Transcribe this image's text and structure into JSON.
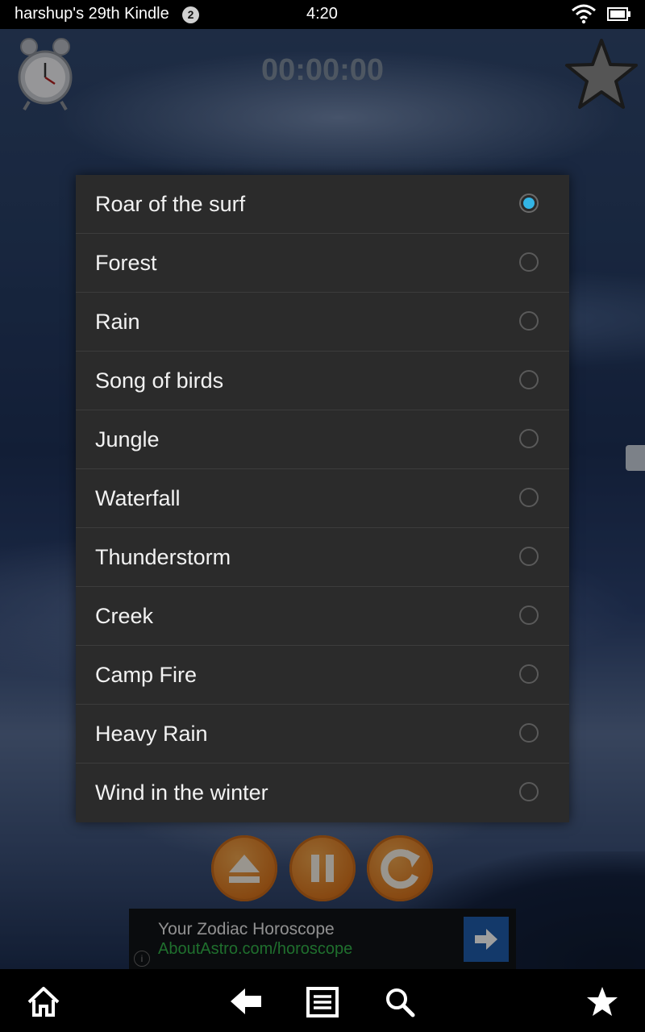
{
  "status_bar": {
    "device_name": "harshup's 29th Kindle",
    "notification_count": "2",
    "time": "4:20",
    "icons": [
      "wifi-icon",
      "battery-icon"
    ]
  },
  "app": {
    "timer": "00:00:00",
    "icons": [
      "alarm-clock-icon",
      "star-icon",
      "eject-icon",
      "pause-icon",
      "repeat-icon"
    ]
  },
  "sound_dialog": {
    "selected_index": 0,
    "options": [
      {
        "label": "Roar of the surf",
        "selected": true
      },
      {
        "label": "Forest",
        "selected": false
      },
      {
        "label": "Rain",
        "selected": false
      },
      {
        "label": "Song of birds",
        "selected": false
      },
      {
        "label": "Jungle",
        "selected": false
      },
      {
        "label": "Waterfall",
        "selected": false
      },
      {
        "label": "Thunderstorm",
        "selected": false
      },
      {
        "label": "Creek",
        "selected": false
      },
      {
        "label": "Camp Fire",
        "selected": false
      },
      {
        "label": "Heavy Rain",
        "selected": false
      },
      {
        "label": "Wind in the winter",
        "selected": false
      }
    ],
    "accent_color": "#33b5e5"
  },
  "ad": {
    "title": "Your Zodiac Horoscope",
    "url": "AboutAstro.com/horoscope",
    "url_color": "#33b34a"
  },
  "nav_bar": {
    "icons": [
      "home-icon",
      "back-icon",
      "menu-icon",
      "search-icon",
      "favorites-star-icon"
    ]
  }
}
